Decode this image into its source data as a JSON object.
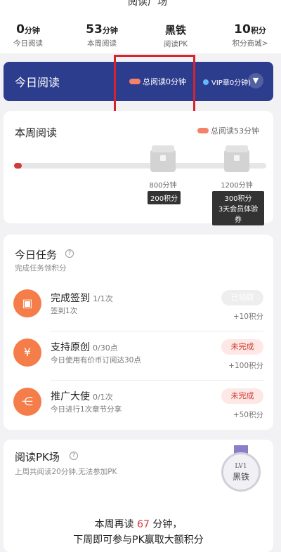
{
  "topbar": {
    "title": "阅读广场",
    "more": "···"
  },
  "stats": [
    {
      "value": "0",
      "unit": "分钟",
      "label": "今日阅读"
    },
    {
      "value": "53",
      "unit": "分钟",
      "label": "本周阅读"
    },
    {
      "value": "黑铁",
      "unit": "",
      "label": "阅读PK"
    },
    {
      "value": "10",
      "unit": "积分",
      "label": "积分商城>"
    }
  ],
  "banner": {
    "title": "今日阅读",
    "total_text": "总阅读0分钟",
    "vip_text": "VIP章0分钟)",
    "expand_icon": "chevron-down"
  },
  "week": {
    "title": "本周阅读",
    "total_text": "总阅读53分钟",
    "progress_fraction": 0.03,
    "milestones": [
      {
        "minutes": "800分钟",
        "points": "200积分",
        "extra": ""
      },
      {
        "minutes": "1200分钟",
        "points": "300积分",
        "extra": "3天会员体验券"
      }
    ]
  },
  "tasks": {
    "title": "今日任务",
    "subtitle": "完成任务领积分",
    "items": [
      {
        "name": "完成签到",
        "progress": "1/1次",
        "desc": "签到1次",
        "status": "已领取",
        "reward": "+10积分",
        "icon": "calendar-check-icon"
      },
      {
        "name": "支持原创",
        "progress": "0/30点",
        "desc": "今日使用有价币订阅达30点",
        "status": "未完成",
        "reward": "+100积分",
        "icon": "yen-coin-icon"
      },
      {
        "name": "推广大使",
        "progress": "0/1次",
        "desc": "今日进行1次章节分享",
        "status": "未完成",
        "reward": "+50积分",
        "icon": "share-icon"
      }
    ]
  },
  "pk": {
    "title": "阅读PK场",
    "subtitle": "上周共阅读20分钟,无法参加PK",
    "badge_level": "LV1",
    "badge_tier": "黑铁",
    "line1_prefix": "本周再读 ",
    "line1_num": "67",
    "line1_suffix": " 分钟，",
    "line2": "下周即可参与PK赢取大额积分"
  },
  "colors": {
    "banner": "#2d3d8e",
    "accent_orange": "#f47d4a",
    "highlight": "#d8232f"
  }
}
